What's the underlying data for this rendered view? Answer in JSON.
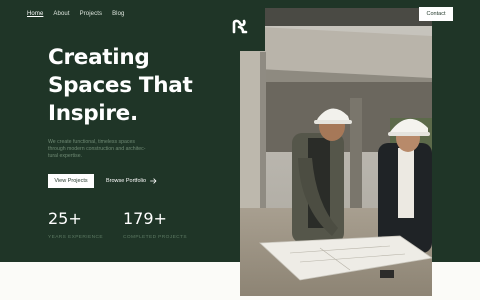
{
  "nav": {
    "items": [
      "Home",
      "About",
      "Projects",
      "Blog"
    ]
  },
  "header": {
    "contact_label": "Contact",
    "logo_letter": "r"
  },
  "hero": {
    "headline_lines": [
      "Creating",
      "Spaces That",
      "Inspire."
    ],
    "subtitle_lines": [
      "We create functional, timeless spaces",
      "through modern construction and architec-",
      "tural expertise."
    ],
    "primary_cta": "View Projects",
    "secondary_cta": "Browse Portfolio",
    "secondary_cta_icon": "arrow-right-icon"
  },
  "stats": [
    {
      "value": "25+",
      "label": "YEARS EXPERIENCE"
    },
    {
      "value": "179+",
      "label": "COMPLETED PROJECTS"
    }
  ],
  "colors": {
    "brand_green": "#1f3527",
    "text_white": "#ffffff",
    "muted_green": "#6f8a74"
  }
}
